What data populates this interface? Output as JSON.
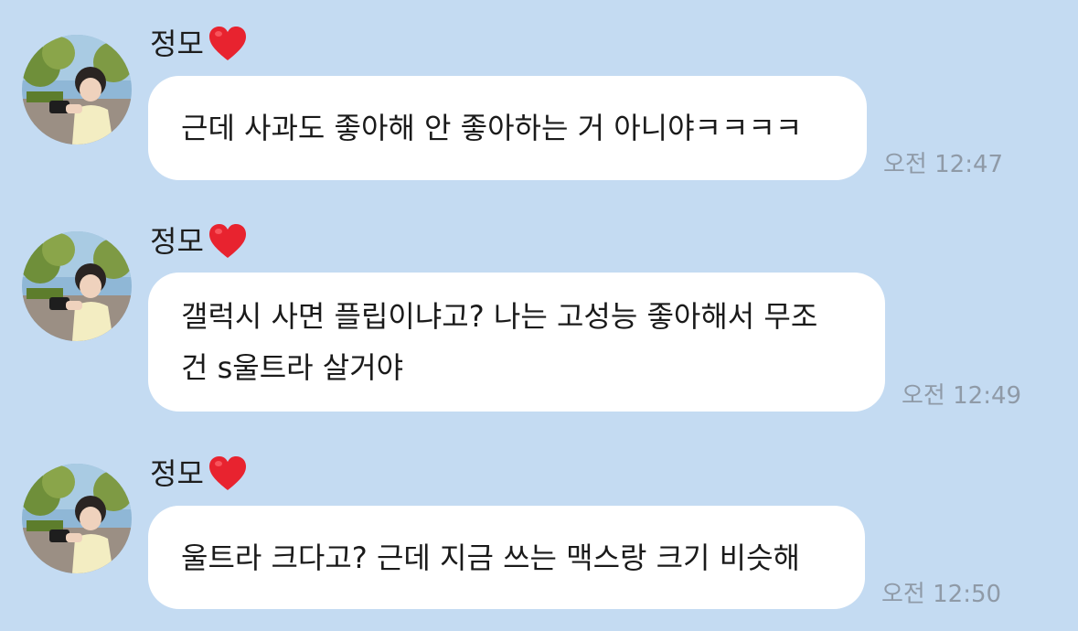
{
  "colors": {
    "background": "#c4dbf2",
    "bubble": "#ffffff",
    "text": "#1a1a1a",
    "timestamp": "#8f9aa7",
    "heart": "#e8232f"
  },
  "messages": [
    {
      "sender": "정모",
      "sender_icon": "red-heart-icon",
      "text": "근데 사과도 좋아해 안 좋아하는 거 아니야ㅋㅋㅋㅋ",
      "time": "오전 12:47"
    },
    {
      "sender": "정모",
      "sender_icon": "red-heart-icon",
      "text_lines": [
        "갤럭시 사면 플립이냐고? 나는 고성능 좋아해서 무조",
        "건 s울트라 살거야"
      ],
      "time": "오전 12:49"
    },
    {
      "sender": "정모",
      "sender_icon": "red-heart-icon",
      "text": "울트라 크다고? 근데 지금 쓰는 맥스랑 크기 비슷해",
      "time": "오전 12:50"
    }
  ]
}
